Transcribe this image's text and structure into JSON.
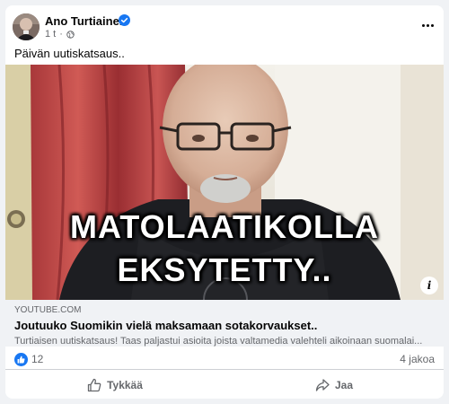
{
  "post": {
    "author": "Ano Turtiainen",
    "time": "1 t",
    "separator": "·",
    "text": "Päivän uutiskatsaus.."
  },
  "media": {
    "overlay_line1": "MATOLAATIKOLLA",
    "overlay_line2": "EKSYTETTY..",
    "info_label": "i"
  },
  "link": {
    "domain": "YOUTUBE.COM",
    "title": "Joutuuko Suomikin vielä maksamaan sotakorvaukset..",
    "description": "Turtiaisen uutiskatsaus! Taas paljastui asioita joista valtamedia valehteli aikoinaan suomalai..."
  },
  "stats": {
    "reaction_count": "12",
    "shares": "4 jakoa"
  },
  "actions": {
    "like": "Tykkää",
    "share": "Jaa"
  },
  "colors": {
    "accent": "#1877f2",
    "secondary_text": "#65676b",
    "link_bg": "#f0f2f5"
  },
  "icons": [
    "verified-icon",
    "globe-icon",
    "more-options-icon",
    "info-icon",
    "like-reaction-icon",
    "thumbs-up-icon",
    "share-arrow-icon"
  ]
}
